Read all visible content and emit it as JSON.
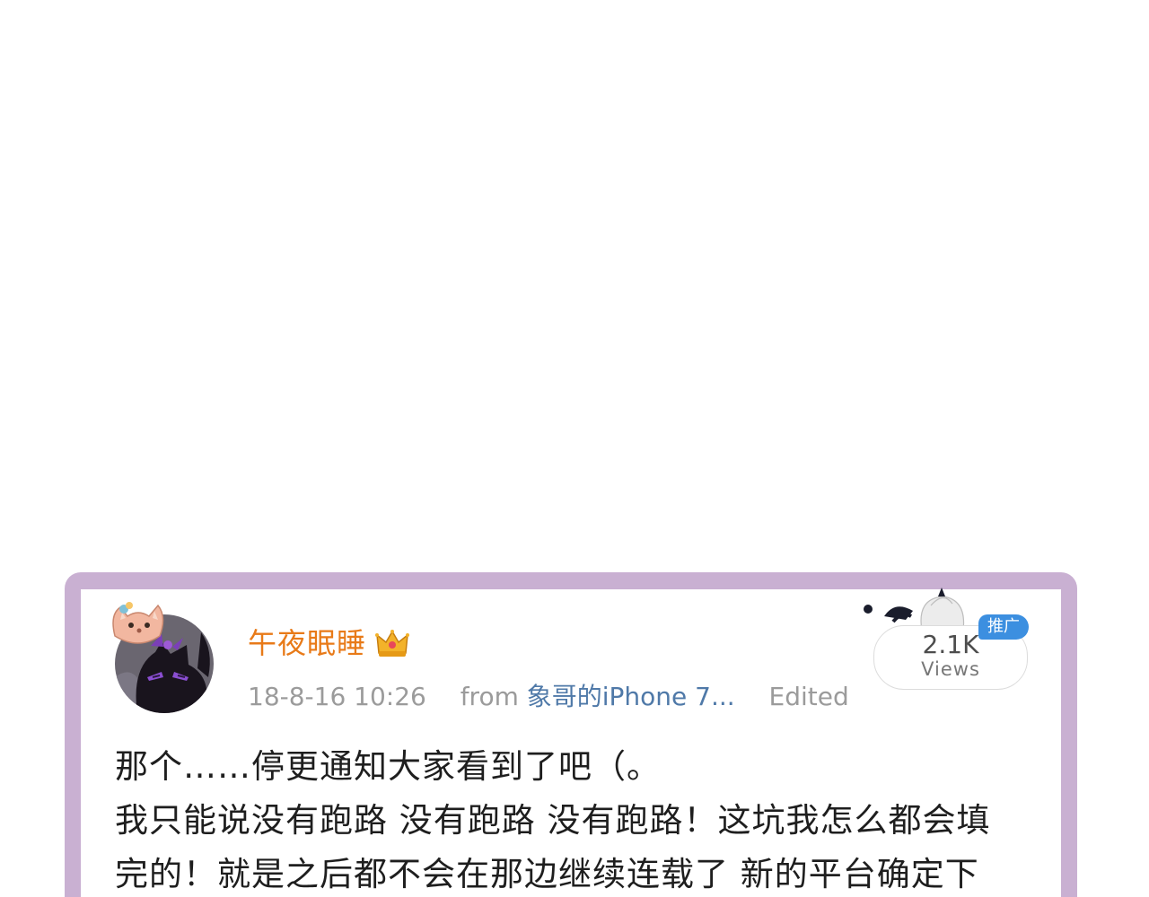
{
  "post": {
    "author": "午夜眠睡",
    "timestamp": "18-8-16 10:26",
    "source_prefix": "from",
    "source": "象哥的iPhone 7...",
    "edited_label": "Edited",
    "views_count": "2.1K",
    "views_label": "Views",
    "promo_tag": "推广",
    "body_lines": [
      "那个……停更通知大家看到了吧（。",
      "我只能说没有跑路 没有跑路 没有跑路！这坑我怎么都会填",
      "完的！就是之后都不会在那边继续连载了 新的平台确定下"
    ]
  },
  "icons": {
    "avatar": "black-cat-avatar-icon",
    "avatar_frame": "pink-fox-frame-icon",
    "badge": "crown-icon",
    "mascot": "white-haired-mascot-icon"
  },
  "colors": {
    "frame": "#c9b0d2",
    "username": "#e87a18",
    "meta": "#9b9b9b",
    "source_link": "#4f79a8",
    "promo": "#3c8fe0",
    "body_text": "#1e1e1e"
  }
}
